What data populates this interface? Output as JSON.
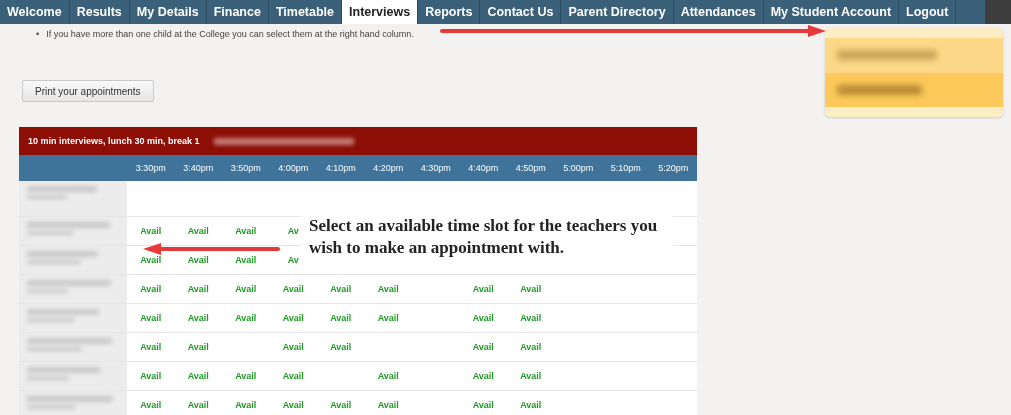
{
  "nav": {
    "tabs": [
      {
        "label": "Welcome",
        "selected": false
      },
      {
        "label": "Results",
        "selected": false
      },
      {
        "label": "My Details",
        "selected": false
      },
      {
        "label": "Finance",
        "selected": false
      },
      {
        "label": "Timetable",
        "selected": false
      },
      {
        "label": "Interviews",
        "selected": true
      },
      {
        "label": "Reports",
        "selected": false
      },
      {
        "label": "Contact Us",
        "selected": false
      },
      {
        "label": "Parent Directory",
        "selected": false
      },
      {
        "label": "Attendances",
        "selected": false
      },
      {
        "label": "My Student Account",
        "selected": false
      },
      {
        "label": "Logout",
        "selected": false
      }
    ]
  },
  "notes": [
    {
      "bullet": "•",
      "text": "If you have more than one child at the College you can select them at the right hand column."
    }
  ],
  "print_button": "Print your appointments",
  "schedule": {
    "title": "10 min interviews, lunch 30 min, break 1",
    "times": [
      "3:30pm",
      "3:40pm",
      "3:50pm",
      "4:00pm",
      "4:10pm",
      "4:20pm",
      "4:30pm",
      "4:40pm",
      "4:50pm",
      "5:00pm",
      "5:10pm",
      "5:20pm"
    ],
    "rows": [
      {
        "slots": [
          {
            "kind": "empty"
          },
          {
            "kind": "empty"
          },
          {
            "kind": "empty"
          },
          {
            "kind": "empty"
          },
          {
            "kind": "empty"
          },
          {
            "kind": "empty"
          },
          {
            "kind": "empty"
          },
          {
            "kind": "empty"
          },
          {
            "kind": "empty"
          },
          {
            "kind": "empty"
          },
          {
            "kind": "empty"
          },
          {
            "kind": "empty"
          }
        ]
      },
      {
        "slots": [
          {
            "kind": "open",
            "label": "Avail"
          },
          {
            "kind": "open",
            "label": "Avail"
          },
          {
            "kind": "open",
            "label": "Avail"
          },
          {
            "kind": "open",
            "label": "Av"
          }
        ]
      },
      {
        "slots": [
          {
            "kind": "open",
            "label": "Avail"
          },
          {
            "kind": "open",
            "label": "Avail"
          },
          {
            "kind": "open",
            "label": "Avail"
          },
          {
            "kind": "open",
            "label": "Av"
          }
        ]
      },
      {
        "slots": [
          {
            "kind": "open",
            "label": "Avail"
          },
          {
            "kind": "open",
            "label": "Avail"
          },
          {
            "kind": "open",
            "label": "Avail"
          },
          {
            "kind": "open",
            "label": "Avail"
          },
          {
            "kind": "open",
            "label": "Avail"
          },
          {
            "kind": "open",
            "label": "Avail"
          },
          {
            "kind": "empty"
          },
          {
            "kind": "open",
            "label": "Avail"
          },
          {
            "kind": "open",
            "label": "Avail"
          },
          {
            "kind": "empty"
          },
          {
            "kind": "empty"
          },
          {
            "kind": "empty"
          }
        ]
      },
      {
        "slots": [
          {
            "kind": "open",
            "label": "Avail"
          },
          {
            "kind": "open",
            "label": "Avail"
          },
          {
            "kind": "open",
            "label": "Avail"
          },
          {
            "kind": "open",
            "label": "Avail"
          },
          {
            "kind": "open",
            "label": "Avail"
          },
          {
            "kind": "open",
            "label": "Avail"
          },
          {
            "kind": "empty"
          },
          {
            "kind": "open",
            "label": "Avail"
          },
          {
            "kind": "open",
            "label": "Avail"
          },
          {
            "kind": "empty"
          },
          {
            "kind": "empty"
          },
          {
            "kind": "empty"
          }
        ]
      },
      {
        "slots": [
          {
            "kind": "open",
            "label": "Avail"
          },
          {
            "kind": "open",
            "label": "Avail"
          },
          {
            "kind": "empty"
          },
          {
            "kind": "open",
            "label": "Avail"
          },
          {
            "kind": "open",
            "label": "Avail"
          },
          {
            "kind": "empty"
          },
          {
            "kind": "empty"
          },
          {
            "kind": "open",
            "label": "Avail"
          },
          {
            "kind": "open",
            "label": "Avail"
          },
          {
            "kind": "empty"
          },
          {
            "kind": "empty"
          },
          {
            "kind": "empty"
          }
        ]
      },
      {
        "slots": [
          {
            "kind": "open",
            "label": "Avail"
          },
          {
            "kind": "open",
            "label": "Avail"
          },
          {
            "kind": "open",
            "label": "Avail"
          },
          {
            "kind": "open",
            "label": "Avail"
          },
          {
            "kind": "empty"
          },
          {
            "kind": "open",
            "label": "Avail"
          },
          {
            "kind": "empty"
          },
          {
            "kind": "open",
            "label": "Avail"
          },
          {
            "kind": "open",
            "label": "Avail"
          },
          {
            "kind": "empty"
          },
          {
            "kind": "empty"
          },
          {
            "kind": "empty"
          }
        ]
      },
      {
        "slots": [
          {
            "kind": "open",
            "label": "Avail"
          },
          {
            "kind": "open",
            "label": "Avail"
          },
          {
            "kind": "open",
            "label": "Avail"
          },
          {
            "kind": "open",
            "label": "Avail"
          },
          {
            "kind": "open",
            "label": "Avail"
          },
          {
            "kind": "open",
            "label": "Avail"
          },
          {
            "kind": "empty"
          },
          {
            "kind": "open",
            "label": "Avail"
          },
          {
            "kind": "open",
            "label": "Avail"
          },
          {
            "kind": "empty"
          },
          {
            "kind": "empty"
          },
          {
            "kind": "empty"
          }
        ]
      }
    ]
  },
  "callout": {
    "text": "Select an available time slot for the teachers you wish to make an appointment with."
  }
}
